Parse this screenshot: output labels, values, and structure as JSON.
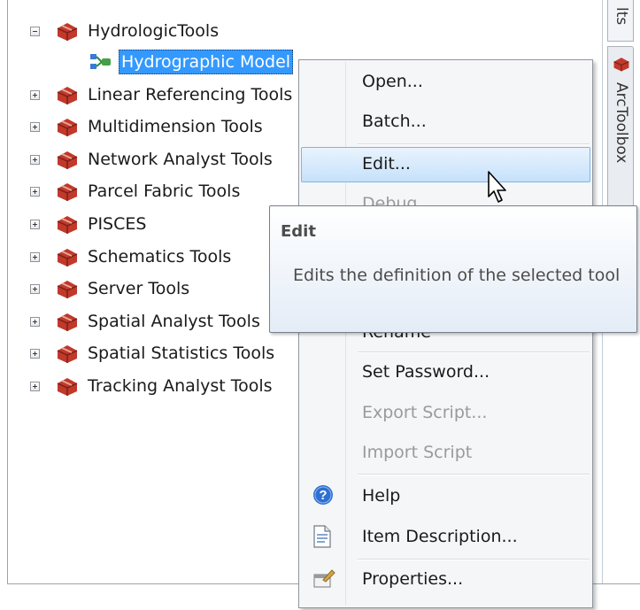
{
  "tree": {
    "items": [
      {
        "label": "HydrologicTools",
        "expanded": true
      },
      {
        "label": "Hydrographic Model",
        "child": true,
        "selected": true
      },
      {
        "label": "Linear Referencing Tools"
      },
      {
        "label": "Multidimension Tools"
      },
      {
        "label": "Network Analyst Tools"
      },
      {
        "label": "Parcel Fabric Tools"
      },
      {
        "label": "PISCES"
      },
      {
        "label": "Schematics Tools"
      },
      {
        "label": "Server Tools"
      },
      {
        "label": "Spatial Analyst Tools"
      },
      {
        "label": "Spatial Statistics Tools"
      },
      {
        "label": "Tracking Analyst Tools"
      }
    ]
  },
  "tabs": {
    "top_label": "lts",
    "arctoolbox_label": "ArcToolbox"
  },
  "menu": {
    "items": [
      {
        "label": "Open...",
        "enabled": true
      },
      {
        "label": "Batch...",
        "enabled": true
      },
      {
        "label": "Edit...",
        "enabled": true,
        "hover": true
      },
      {
        "label": "Debug",
        "enabled": false
      },
      {
        "label": "Rename",
        "enabled": true
      },
      {
        "label": "Set Password...",
        "enabled": true
      },
      {
        "label": "Export Script...",
        "enabled": false
      },
      {
        "label": "Import Script",
        "enabled": false
      },
      {
        "label": "Help",
        "enabled": true,
        "icon": "help-icon"
      },
      {
        "label": "Item Description...",
        "enabled": true,
        "icon": "document-icon"
      },
      {
        "label": "Properties...",
        "enabled": true,
        "icon": "properties-icon"
      }
    ]
  },
  "tooltip": {
    "title": "Edit",
    "body": "Edits the definition of the selected tool"
  },
  "colors": {
    "selection": "#3399ff",
    "menu_hover": "#c6e1fb",
    "toolbox_red": "#c0392b"
  }
}
